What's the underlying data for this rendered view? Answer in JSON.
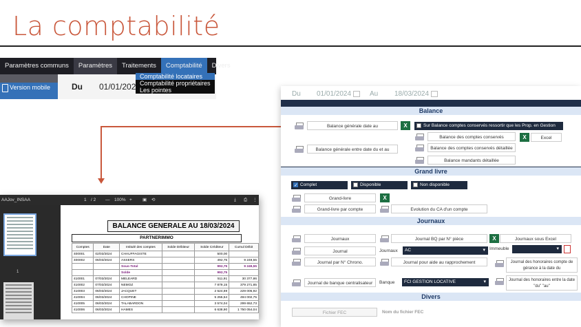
{
  "slide_title": "La comptabilité",
  "menu": {
    "items": [
      "Paramètres communs",
      "Paramètres",
      "Traitements",
      "Comptabilité",
      "Divers"
    ],
    "dropdown": [
      "Comptabilité locataires",
      "Comptabilité propriétaires",
      "Les pointes"
    ],
    "sidebar_item": "Version mobile",
    "du_label": "Du",
    "du_value": "01/01/2024"
  },
  "pdf": {
    "filename": "AAJov_INSAA",
    "page_current": "1",
    "page_total": "/ 2",
    "zoom": "100%",
    "thumb_label": "1",
    "title": "BALANCE GENERALE AU  18/03/2024",
    "partner": "PARTNERIMMO",
    "headers": [
      "Comptes",
      "Date",
      "Intitulé des comptes",
      "Solde Débiteur",
      "Solde Créditeur",
      "Cumul Débit"
    ],
    "rows": [
      [
        "400001",
        "02/03/2024",
        "CHAUFFAGISTE",
        "",
        "500,00",
        ""
      ],
      [
        "400002",
        "06/03/2024",
        "ASSERS",
        "",
        "492,75",
        "9 249,55"
      ],
      [
        "",
        "",
        "Sous-Total",
        "",
        "992,75",
        "9 249,55"
      ],
      [
        "",
        "",
        "Solde",
        "",
        "992,75",
        ""
      ],
      [
        "410001",
        "07/03/2024",
        "MELEARD",
        "",
        "511,91",
        "30 377,86"
      ],
      [
        "410002",
        "07/03/2024",
        "NEMOZ",
        "",
        "7 879,15",
        "379 271,85"
      ],
      [
        "410003",
        "06/03/2024",
        "JACQUET",
        "",
        "2 524,69",
        "229 005,92"
      ],
      [
        "410004",
        "06/03/2024",
        "CHOPINE",
        "",
        "5 255,54",
        "494 002,75"
      ],
      [
        "410005",
        "06/03/2024",
        "TALABARDON",
        "",
        "3 574,04",
        "299 652,73"
      ],
      [
        "410006",
        "06/03/2024",
        "HAMES",
        "",
        "6 638,90",
        "1 750 054,04"
      ]
    ]
  },
  "panel": {
    "du_label": "Du",
    "du_value": "01/01/2024",
    "au_label": "Au",
    "au_value": "18/03/2024",
    "balance": {
      "header": "Balance",
      "btn_generale_date": "Balance générale date au",
      "chk_conserves": "Sur Balance comptes conservés ressortir que les Prop. en Gestion",
      "btn_conserves": "Balance des comptes conservés",
      "btn_excel": "Excel",
      "btn_conserves_detail": "Balance des comptes conservés détaillée",
      "btn_entre_dates": "Balance générale entre date du et au",
      "btn_mandants": "Balance mandants détaillée"
    },
    "grand_livre": {
      "header": "Grand livre",
      "opt_complet": "Complet",
      "opt_disponible": "Disponible",
      "opt_non_disponible": "Non disponible",
      "btn_grand_livre": "Grand-livre",
      "btn_par_compte": "Grand-livre par compte",
      "btn_evolution": "Evolution du CA d'un compte"
    },
    "journaux": {
      "header": "Journaux",
      "btn_journaux": "Journaux",
      "btn_journal_bq": "Journal BQ par N° pièce",
      "btn_sous_excel": "Journaux sous Excel",
      "btn_journal": "Journal",
      "lbl_journaux": "Journaux",
      "val_journaux": "AC",
      "lbl_immeuble": "Immeuble",
      "btn_chrono": "Journal par N° Chrono.",
      "btn_rapprochement": "Journal pour aide au rapprochement",
      "btn_honoraires_date": "Journal des honoraires compte de gérance à la date du",
      "btn_banque_centralisateur": "Journal de banque centralisateur",
      "lbl_banque": "Banque",
      "val_banque": "FCI GESTION LOCATIVE",
      "btn_honoraires_entre": "Journal des honoraires entre la date \"du\" \"au\""
    },
    "divers": {
      "header": "Divers",
      "btn_fichier_fec": "Fichier FEC",
      "lbl_nom_fec": "Nom du fichier FEC"
    }
  },
  "colors": {
    "title": "#c9573b",
    "accent": "#3471b8",
    "dark": "#1e2a3e",
    "excel": "#1d6f42"
  }
}
